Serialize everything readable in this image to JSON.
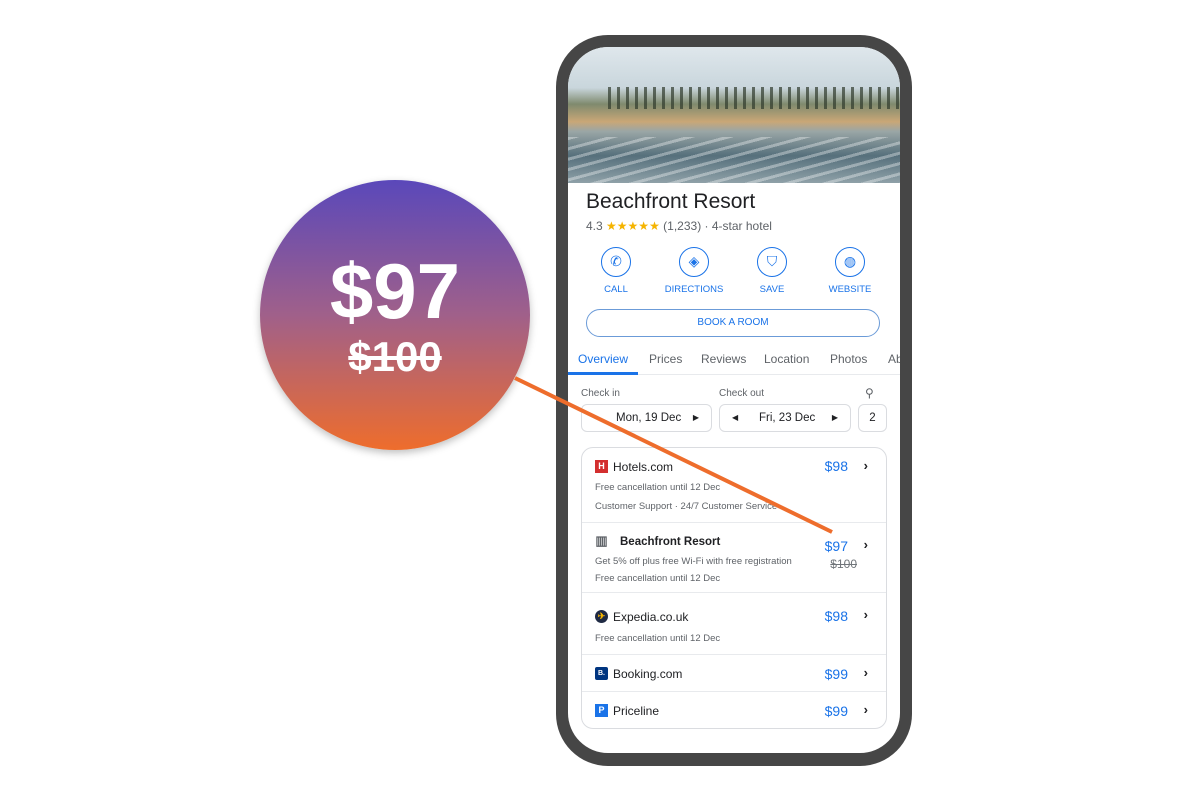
{
  "hotel": {
    "name": "Beachfront Resort",
    "rating": "4.3",
    "stars": "★★★★★",
    "review_count": "(1,233)",
    "category": "· 4-star hotel"
  },
  "actions": [
    {
      "label": "CALL",
      "icon": "phone-icon",
      "glyph": "✆"
    },
    {
      "label": "DIRECTIONS",
      "icon": "directions-icon",
      "glyph": "◈"
    },
    {
      "label": "SAVE",
      "icon": "bookmark-icon",
      "glyph": "⛉"
    },
    {
      "label": "WEBSITE",
      "icon": "globe-icon",
      "glyph": "◍"
    }
  ],
  "book_label": "BOOK A ROOM",
  "tabs": [
    "Overview",
    "Prices",
    "Reviews",
    "Location",
    "Photos",
    "Ab"
  ],
  "dates": {
    "checkin_label": "Check in",
    "checkin": "Mon, 19 Dec",
    "checkout_label": "Check out",
    "checkout": "Fri, 23 Dec",
    "guests": "2"
  },
  "offers": [
    {
      "name": "Hotels.com",
      "price": "$98",
      "lines": [
        "Free cancellation until 12 Dec",
        "Customer Support · 24/7 Customer Service"
      ],
      "logo_color": "#d32f2f",
      "logo": "H"
    },
    {
      "name": "Beachfront Resort",
      "price": "$97",
      "old_price": "$100",
      "lines": [
        "Get 5% off plus free Wi-Fi with free registration",
        "Free cancellation until 12 Dec"
      ],
      "logo": "▥"
    },
    {
      "name": "Expedia.co.uk",
      "price": "$98",
      "lines": [
        "Free cancellation until 12 Dec"
      ],
      "logo_color": "#1f2a44",
      "logo": "✈"
    },
    {
      "name": "Booking.com",
      "price": "$99",
      "lines": [],
      "logo_color": "#003580",
      "logo": "B."
    },
    {
      "name": "Priceline",
      "price": "$99",
      "lines": [],
      "logo_color": "#1a73e8",
      "logo": "P"
    }
  ],
  "callout": {
    "price": "$97",
    "old_price": "$100",
    "gradient": [
      "#5a48ba",
      "#ee6d2c"
    ]
  },
  "colors": {
    "accent": "#1a73e8",
    "pointer": "#ee6d2c"
  }
}
